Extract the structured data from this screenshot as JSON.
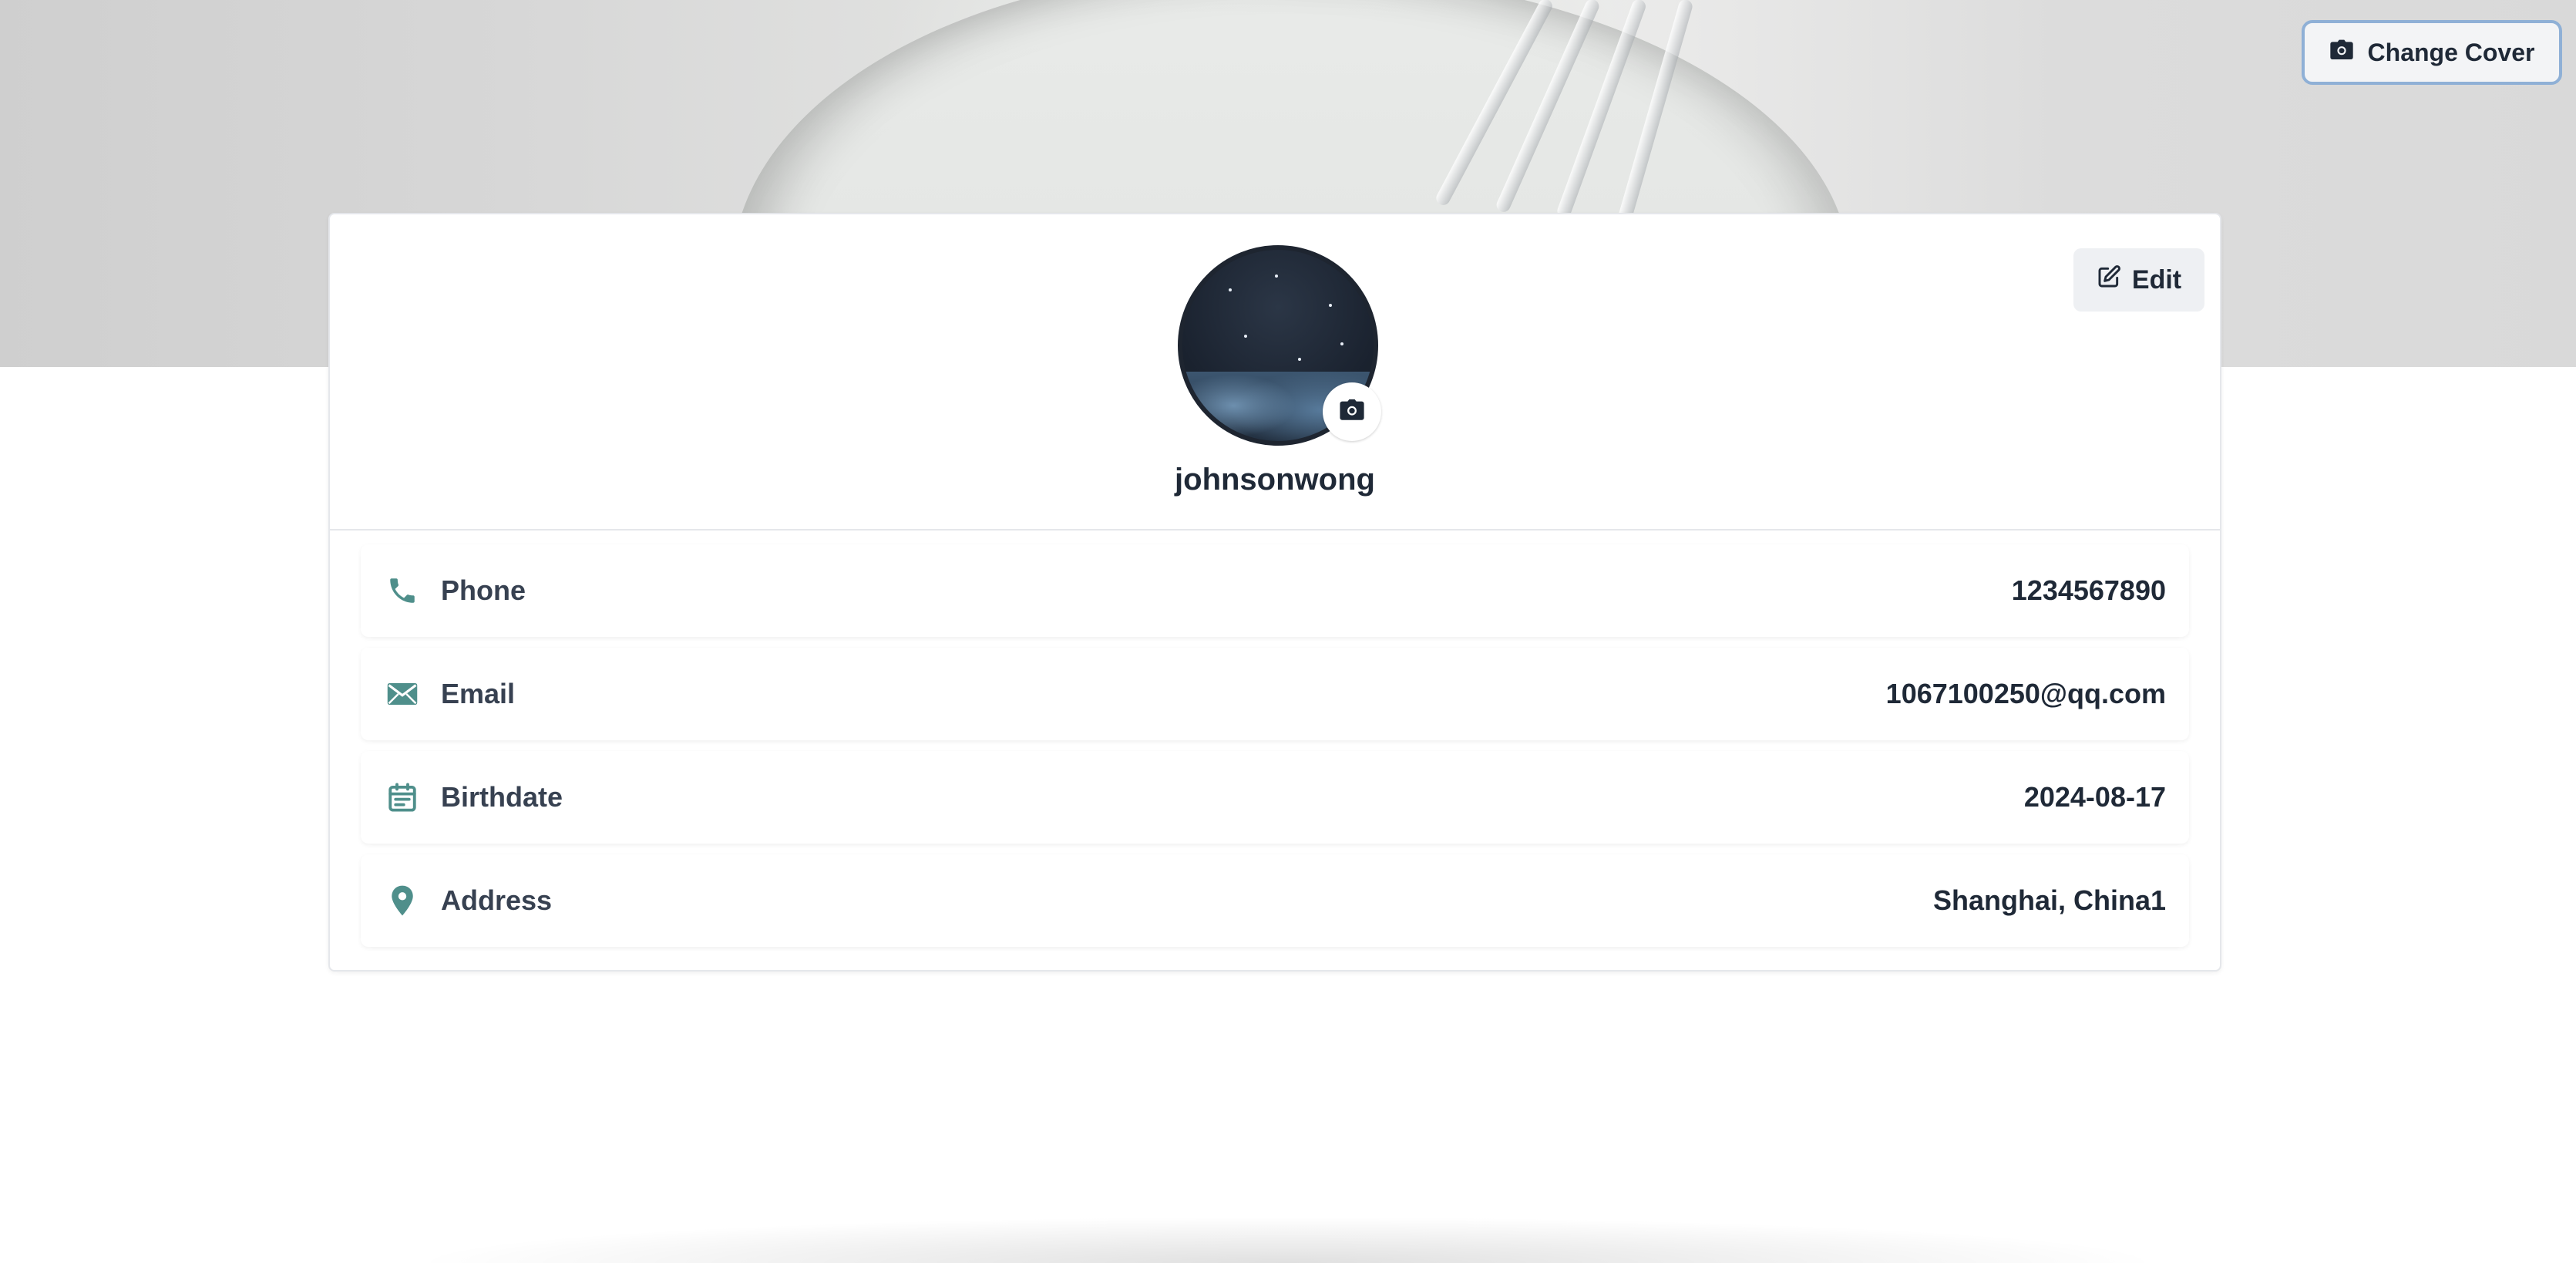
{
  "cover": {
    "change_cover_label": "Change Cover"
  },
  "profile": {
    "edit_label": "Edit",
    "username": "johnsonwong"
  },
  "fields": [
    {
      "label": "Phone",
      "value": "1234567890",
      "icon": "phone-icon"
    },
    {
      "label": "Email",
      "value": "1067100250@qq.com",
      "icon": "mail-icon"
    },
    {
      "label": "Birthdate",
      "value": "2024-08-17",
      "icon": "calendar-icon"
    },
    {
      "label": "Address",
      "value": "Shanghai, China1",
      "icon": "location-pin-icon"
    }
  ],
  "colors": {
    "accent": "#4f8f8b",
    "text": "#1f2937",
    "button_bg": "#eef0f3",
    "focus_ring": "#8fb0d6"
  }
}
